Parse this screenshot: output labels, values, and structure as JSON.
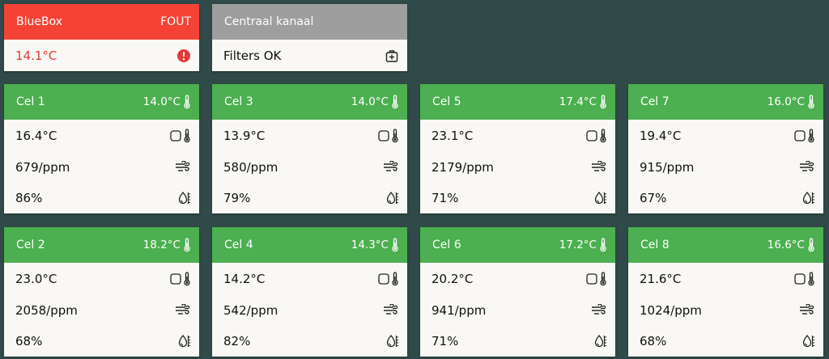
{
  "bluebox": {
    "title": "BlueBox",
    "status": "FOUT",
    "temperature": "14.1°C",
    "icon": "alert-circle-icon",
    "color": "#f44336"
  },
  "central": {
    "title": "Centraal kanaal",
    "status_text": "Filters OK",
    "icon": "medical-bag-icon"
  },
  "cells": [
    {
      "name": "Cel 1",
      "setpoint": "14.0°C",
      "temperature": "16.4°C",
      "co2": "679/ppm",
      "humidity": "86%"
    },
    {
      "name": "Cel 3",
      "setpoint": "14.0°C",
      "temperature": "13.9°C",
      "co2": "580/ppm",
      "humidity": "79%"
    },
    {
      "name": "Cel 5",
      "setpoint": "17.4°C",
      "temperature": "23.1°C",
      "co2": "2179/ppm",
      "humidity": "71%"
    },
    {
      "name": "Cel 7",
      "setpoint": "16.0°C",
      "temperature": "19.4°C",
      "co2": "915/ppm",
      "humidity": "67%"
    },
    {
      "name": "Cel 2",
      "setpoint": "18.2°C",
      "temperature": "23.0°C",
      "co2": "2058/ppm",
      "humidity": "68%"
    },
    {
      "name": "Cel 4",
      "setpoint": "14.3°C",
      "temperature": "14.2°C",
      "co2": "542/ppm",
      "humidity": "82%"
    },
    {
      "name": "Cel 6",
      "setpoint": "17.2°C",
      "temperature": "20.2°C",
      "co2": "941/ppm",
      "humidity": "71%"
    },
    {
      "name": "Cel 8",
      "setpoint": "16.6°C",
      "temperature": "21.6°C",
      "co2": "1024/ppm",
      "humidity": "68%"
    }
  ],
  "icons": {
    "setpoint": "thermometer-icon",
    "temperature": "room-thermometer-icon",
    "co2": "air-flow-icon",
    "humidity": "water-percent-icon"
  },
  "colors": {
    "background": "#2f4a48",
    "header_ok": "#4caf50",
    "header_error": "#f44336",
    "header_neutral": "#9e9e9e",
    "card": "#f9f8f4"
  }
}
